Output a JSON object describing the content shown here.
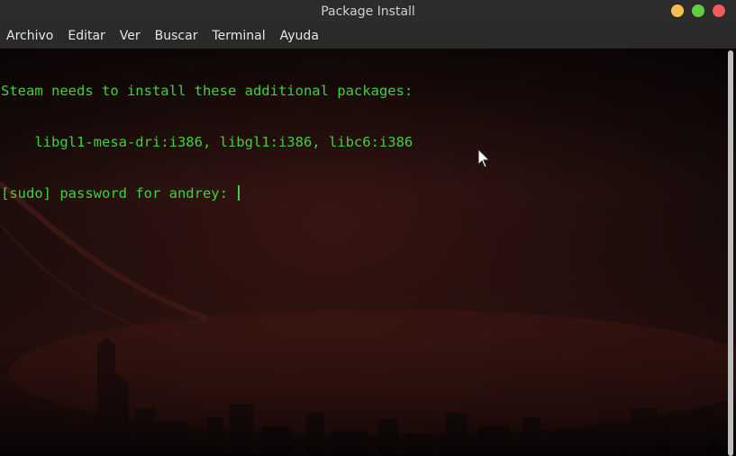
{
  "window": {
    "title": "Package Install"
  },
  "menubar": {
    "items": [
      "Archivo",
      "Editar",
      "Ver",
      "Buscar",
      "Terminal",
      "Ayuda"
    ]
  },
  "terminal": {
    "lines": [
      "Steam needs to install these additional packages:",
      "    libgl1-mesa-dri:i386, libgl1:i386, libc6:i386",
      "[sudo] password for andrey: "
    ],
    "text_color": "#3fd23a",
    "background_theme": "dark red city skyline wallpaper"
  },
  "icons": {
    "mouse_pointer": "mouse-pointer-icon"
  },
  "colors": {
    "titlebar": "#2c2c2c",
    "menubar": "#2a2a2a",
    "minimize": "#f5bf4f",
    "maximize": "#5fcf40",
    "close": "#ef5b5b"
  }
}
